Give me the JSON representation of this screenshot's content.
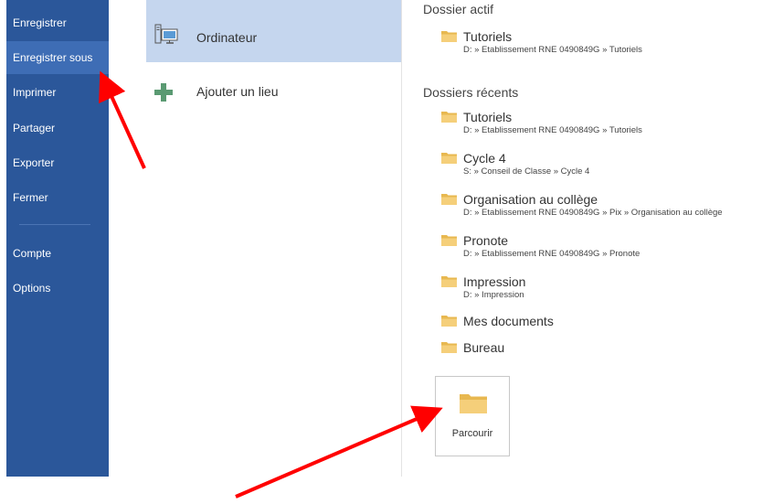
{
  "sidebar": {
    "items": [
      {
        "label": "Enregistrer"
      },
      {
        "label": "Enregistrer sous"
      },
      {
        "label": "Imprimer"
      },
      {
        "label": "Partager"
      },
      {
        "label": "Exporter"
      },
      {
        "label": "Fermer"
      },
      {
        "label": "Compte"
      },
      {
        "label": "Options"
      }
    ],
    "active_index": 1
  },
  "places": [
    {
      "label": "Ordinateur",
      "icon": "computer-icon"
    },
    {
      "label": "Ajouter un lieu",
      "icon": "plus-icon"
    }
  ],
  "current": {
    "title": "Dossier actif",
    "folder": {
      "name": "Tutoriels",
      "path": "D: » Etablissement RNE 0490849G » Tutoriels"
    }
  },
  "recent": {
    "title": "Dossiers récents",
    "folders": [
      {
        "name": "Tutoriels",
        "path": "D: » Etablissement RNE 0490849G » Tutoriels"
      },
      {
        "name": "Cycle 4",
        "path": "S: » Conseil de Classe » Cycle 4"
      },
      {
        "name": "Organisation au collège",
        "path": "D: » Etablissement RNE 0490849G » Pix » Organisation au collège"
      },
      {
        "name": "Pronote",
        "path": "D: » Etablissement RNE 0490849G » Pronote"
      },
      {
        "name": "Impression",
        "path": "D: » Impression"
      },
      {
        "name": "Mes documents",
        "path": ""
      },
      {
        "name": "Bureau",
        "path": ""
      }
    ]
  },
  "browse": {
    "label": "Parcourir",
    "icon": "folder-icon"
  },
  "colors": {
    "sidebar_bg": "#2b579a",
    "sidebar_active": "#3e6db5",
    "selected_place": "#c5d6ee",
    "folder": "#f2c66b",
    "plus": "#5a9a72",
    "annotation_arrow": "#ff0000"
  }
}
